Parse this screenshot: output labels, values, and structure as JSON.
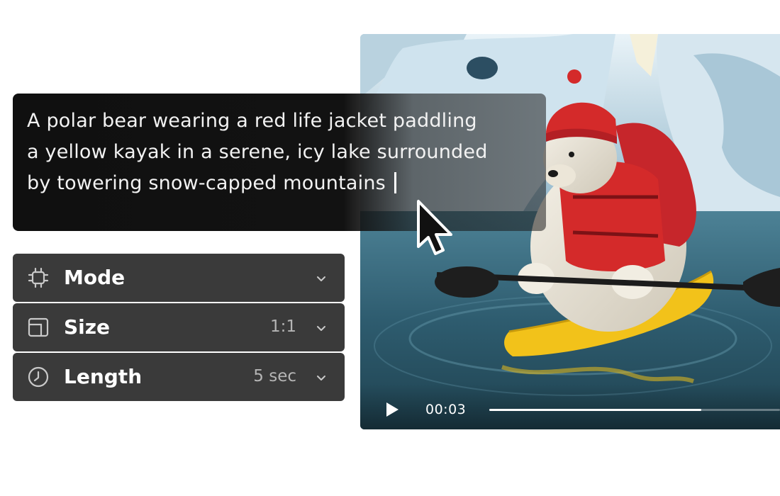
{
  "prompt": {
    "text": "A polar bear wearing a red life jacket paddling a yellow kayak in a serene, icy lake surrounded by towering snow-capped mountains"
  },
  "settings": {
    "mode": {
      "label": "Mode",
      "icon": "chip-icon"
    },
    "size": {
      "label": "Size",
      "value": "1:1",
      "icon": "aspect-ratio-icon"
    },
    "length": {
      "label": "Length",
      "value": "5 sec",
      "icon": "clock-icon"
    }
  },
  "player": {
    "timecode": "00:03",
    "progress": 0.73,
    "play_icon": "play-icon"
  },
  "colors": {
    "prompt_bg": "#111111",
    "row_bg": "#3a3a3a",
    "kayak": "#f2c21a",
    "jacket": "#d42a2a",
    "water": "#2f5e72"
  }
}
